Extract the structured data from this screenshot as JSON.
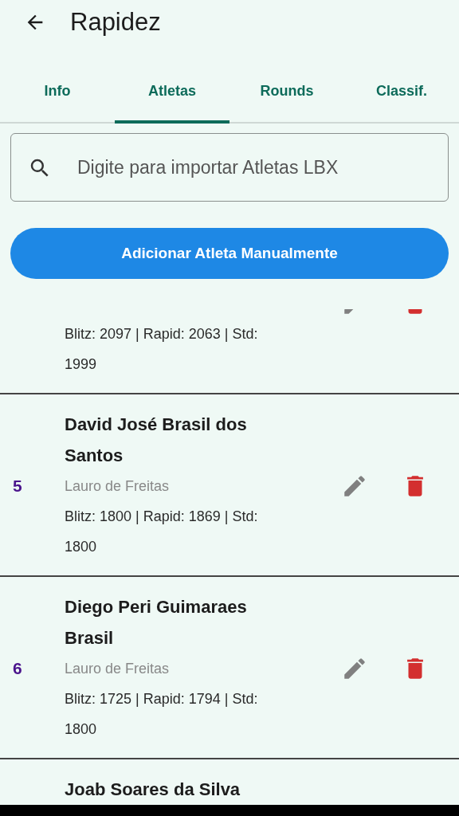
{
  "app_bar": {
    "title": "Rapidez"
  },
  "tabs": [
    {
      "label": "Info",
      "selected": false
    },
    {
      "label": "Atletas",
      "selected": true
    },
    {
      "label": "Rounds",
      "selected": false
    },
    {
      "label": "Classif.",
      "selected": false
    }
  ],
  "search": {
    "placeholder": "Digite para importar Atletas LBX"
  },
  "add_button": "Adicionar Atleta Manualmente",
  "athletes": [
    {
      "kind": "cut_top",
      "ratings": "Blitz: 2097 | Rapid: 2063 | Std: 1999"
    },
    {
      "kind": "full",
      "number": "5",
      "name": "David José Brasil dos Santos",
      "city": "Lauro de Freitas",
      "ratings": "Blitz: 1800 | Rapid: 1869 | Std: 1800"
    },
    {
      "kind": "full",
      "number": "6",
      "name": "Diego Peri Guimaraes Brasil",
      "city": "Lauro de Freitas",
      "ratings": "Blitz: 1725 | Rapid: 1794 | Std: 1800"
    },
    {
      "kind": "cut_bottom",
      "name": "Joab Soares da Silva"
    }
  ]
}
